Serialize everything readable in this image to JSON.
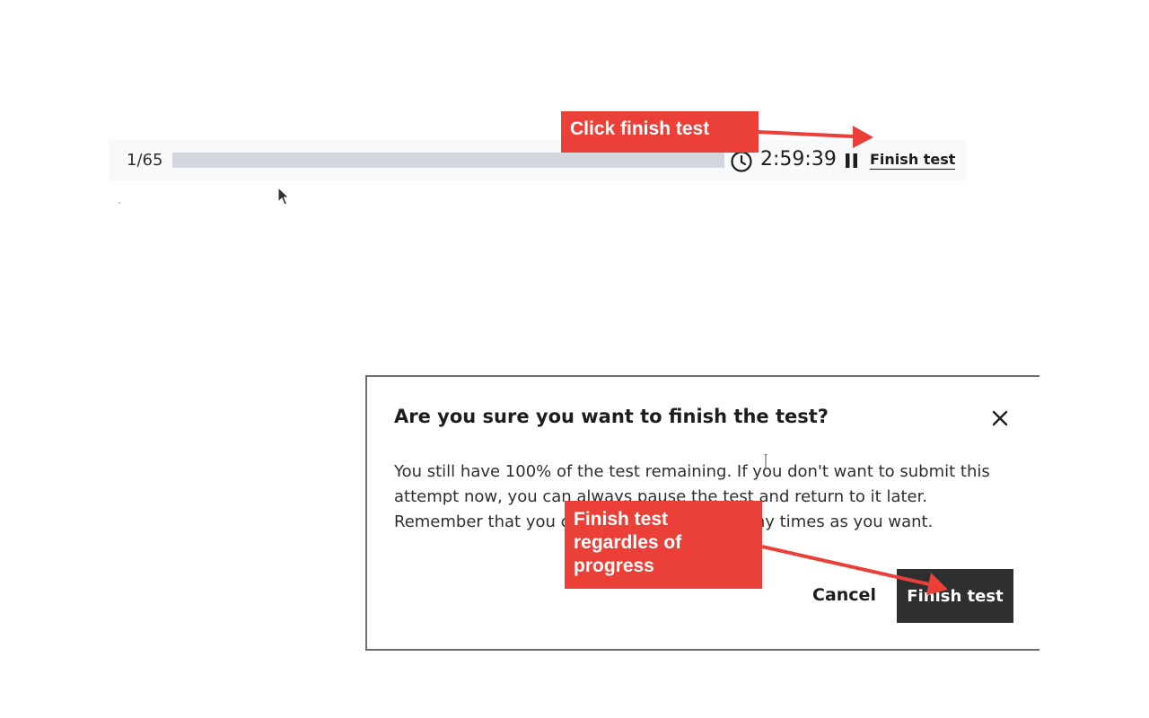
{
  "test_bar": {
    "question_counter": "1/65",
    "progress": 0,
    "timer": "2:59:39",
    "finish_link": "Finish test",
    "clock_icon": "clock-icon",
    "pause_icon": "pause-icon"
  },
  "modal": {
    "title": "Are you sure you want to finish the test?",
    "body": "You still have 100% of the test remaining. If you don't want to submit this attempt now, you can always pause the test and return to it later. Remember that you can take this test as many times as you want.",
    "cancel_label": "Cancel",
    "finish_label": "Finish test",
    "close_icon": "close-icon"
  },
  "annotations": {
    "top_callout": "Click finish test",
    "mid_callout": "Finish test\nregardles of\nprogress",
    "color": "#ea4037"
  },
  "colors": {
    "bar_background": "#f7f9fa",
    "progress_track": "#d1d7dc",
    "primary_button": "#2d2f31",
    "annotation": "#ea4037"
  }
}
